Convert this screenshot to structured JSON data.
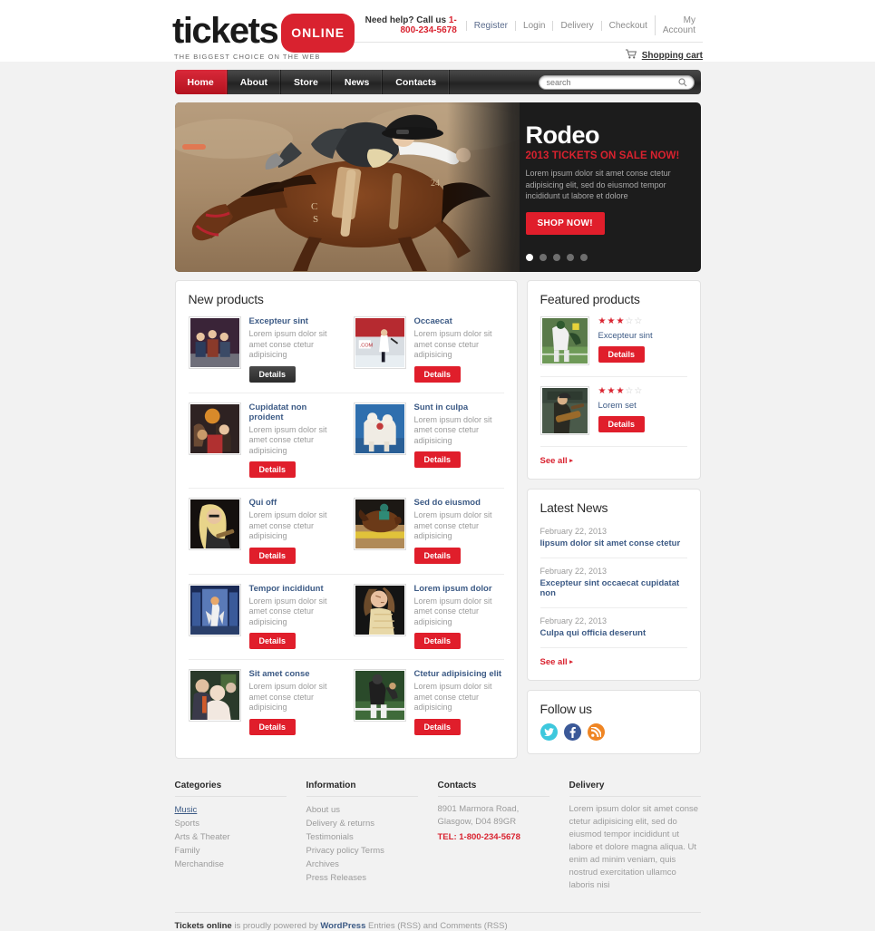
{
  "header": {
    "logo_main": "tickets",
    "logo_badge": "ONLINE",
    "tagline": "THE BIGGEST CHOICE ON THE WEB",
    "need_help_label": "Need help? Call us",
    "phone": "1-800-234-5678",
    "links": [
      "Register",
      "Login",
      "Delivery",
      "Checkout",
      "My Account"
    ],
    "cart_label": "Shopping cart",
    "cart_icon": "cart-icon"
  },
  "nav": {
    "items": [
      "Home",
      "About",
      "Store",
      "News",
      "Contacts"
    ],
    "active_index": 0,
    "search_placeholder": "search",
    "search_value": "",
    "search_icon": "search-icon"
  },
  "hero": {
    "title": "Rodeo",
    "subtitle": "2013 TICKETS ON SALE NOW!",
    "text": "Lorem ipsum dolor sit amet conse ctetur adipisicing elit, sed do eiusmod tempor incididunt ut labore et dolore",
    "button": "SHOP NOW!",
    "slides": 5,
    "active_slide": 0,
    "accent": "#d9222f"
  },
  "new_products": {
    "title": "New products",
    "items": [
      {
        "name": "Excepteur sint",
        "desc": "Lorem ipsum dolor sit amet conse ctetur adipisicing",
        "button": "Details",
        "dark": true
      },
      {
        "name": "Occaecat",
        "desc": "Lorem ipsum dolor sit amet conse ctetur adipisicing",
        "button": "Details",
        "dark": false
      },
      {
        "name": "Cupidatat non proident",
        "desc": "Lorem ipsum dolor sit amet conse ctetur adipisicing",
        "button": "Details",
        "dark": false
      },
      {
        "name": "Sunt in culpa",
        "desc": "Lorem ipsum dolor sit amet conse ctetur adipisicing",
        "button": "Details",
        "dark": false
      },
      {
        "name": "Qui off",
        "desc": "Lorem ipsum dolor sit amet conse ctetur adipisicing",
        "button": "Details",
        "dark": false
      },
      {
        "name": "Sed do eiusmod",
        "desc": "Lorem ipsum dolor sit amet conse ctetur adipisicing",
        "button": "Details",
        "dark": false
      },
      {
        "name": "Tempor incididunt",
        "desc": "Lorem ipsum dolor sit amet conse ctetur adipisicing",
        "button": "Details",
        "dark": false
      },
      {
        "name": "Lorem ipsum dolor",
        "desc": "Lorem ipsum dolor sit amet conse ctetur adipisicing",
        "button": "Details",
        "dark": false
      },
      {
        "name": "Sit amet conse",
        "desc": "Lorem ipsum dolor sit amet conse ctetur adipisicing",
        "button": "Details",
        "dark": false
      },
      {
        "name": "Ctetur adipisicing elit",
        "desc": "Lorem ipsum dolor sit amet conse ctetur adipisicing",
        "button": "Details",
        "dark": false
      }
    ]
  },
  "featured": {
    "title": "Featured products",
    "see_all": "See all",
    "items": [
      {
        "name": "Excepteur sint",
        "rating": 2.5,
        "max_rating": 5,
        "button": "Details"
      },
      {
        "name": "Lorem set",
        "rating": 2.5,
        "max_rating": 5,
        "button": "Details"
      }
    ]
  },
  "news": {
    "title": "Latest News",
    "see_all": "See all",
    "items": [
      {
        "date": "February 22, 2013",
        "title": "Iipsum dolor sit amet conse ctetur"
      },
      {
        "date": "February 22, 2013",
        "title": "Excepteur sint occaecat cupidatat non"
      },
      {
        "date": "February 22, 2013",
        "title": "Culpa qui officia deserunt"
      }
    ]
  },
  "follow": {
    "title": "Follow us",
    "networks": [
      {
        "name": "twitter-icon",
        "glyph": "✉",
        "color": "#3ec8dd"
      },
      {
        "name": "facebook-icon",
        "glyph": "f",
        "color": "#3b5998"
      },
      {
        "name": "rss-icon",
        "glyph": "◔",
        "color": "#ef8523"
      }
    ]
  },
  "footer": {
    "categories": {
      "title": "Categories",
      "items": [
        "Music",
        "Sports",
        "Arts & Theater",
        "Family",
        "Merchandise"
      ],
      "active_index": 0
    },
    "information": {
      "title": "Information",
      "items": [
        "About us",
        "Delivery & returns",
        "Testimonials",
        "Privacy policy Terms",
        "Archives",
        "Press Releases"
      ]
    },
    "contacts": {
      "title": "Contacts",
      "address": "8901 Marmora Road, Glasgow, D04 89GR",
      "tel": "TEL: 1-800-234-5678"
    },
    "delivery": {
      "title": "Delivery",
      "text": "Lorem ipsum dolor sit amet conse ctetur adipisicing elit, sed do eiusmod tempor incididunt ut labore et dolore magna aliqua. Ut enim ad minim veniam, quis nostrud exercitation ullamco laboris nisi"
    }
  },
  "copyright": {
    "brand": "Tickets online",
    "mid": " is proudly powered by ",
    "wordpress": "WordPress",
    "end": " Entries (RSS) and Comments (RSS)"
  }
}
